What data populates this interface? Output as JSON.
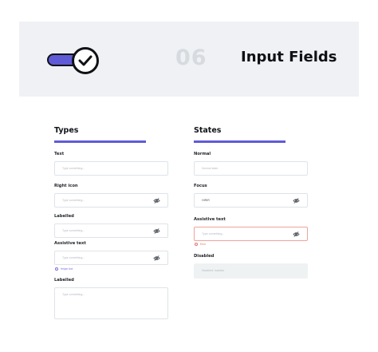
{
  "hero": {
    "number": "06",
    "title": "Input Fields",
    "accent_color": "#5f5bd6",
    "icon": "toggle-switch-check-icon"
  },
  "types": {
    "title": "Types",
    "items": [
      {
        "label": "Text",
        "placeholder": "Type something..."
      },
      {
        "label": "Right icon",
        "placeholder": "Type something...",
        "icon": "eye-off-icon"
      },
      {
        "label": "Labelled",
        "placeholder": "Type something...",
        "icon": "eye-off-icon"
      },
      {
        "label": "Assistive text",
        "placeholder": "Type something...",
        "icon": "eye-off-icon",
        "helper": "Helper text"
      },
      {
        "label": "Labelled",
        "placeholder": "Type something..."
      }
    ]
  },
  "states": {
    "title": "States",
    "items": [
      {
        "label": "Normal",
        "placeholder": "Normal state"
      },
      {
        "label": "Focus",
        "value": "HIRIR",
        "icon": "eye-off-icon"
      },
      {
        "label": "Assistive text",
        "placeholder": "Type something...",
        "icon": "eye-off-icon",
        "helper": "Error"
      },
      {
        "label": "Disabled",
        "placeholder": "Disabled: inactive"
      }
    ]
  }
}
